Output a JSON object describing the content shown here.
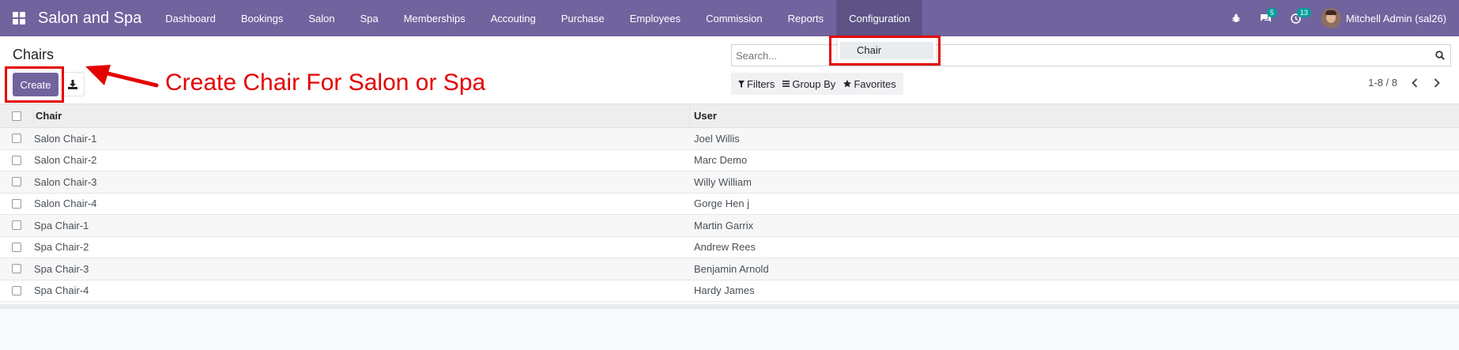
{
  "navbar": {
    "brand": "Salon and Spa",
    "menu": [
      "Dashboard",
      "Bookings",
      "Salon",
      "Spa",
      "Memberships",
      "Accouting",
      "Purchase",
      "Employees",
      "Commission",
      "Reports",
      "Configuration"
    ],
    "messages_count": "5",
    "activities_count": "13",
    "user_name": "Mitchell Admin (sal26)",
    "bg_color": "#71639e"
  },
  "dropdown": {
    "item": "Chair"
  },
  "control": {
    "title": "Chairs",
    "create_label": "Create",
    "search_placeholder": "Search...",
    "filters_label": "Filters",
    "group_by_label": "Group By",
    "favorites_label": "Favorites",
    "pager": "1-8 / 8"
  },
  "table": {
    "headers": {
      "chair": "Chair",
      "user": "User"
    },
    "rows": [
      {
        "chair": "Salon Chair-1",
        "user": "Joel Willis"
      },
      {
        "chair": "Salon Chair-2",
        "user": "Marc Demo"
      },
      {
        "chair": "Salon Chair-3",
        "user": "Willy William"
      },
      {
        "chair": "Salon Chair-4",
        "user": "Gorge Hen j"
      },
      {
        "chair": "Spa Chair-1",
        "user": "Martin Garrix"
      },
      {
        "chair": "Spa Chair-2",
        "user": "Andrew Rees"
      },
      {
        "chair": "Spa Chair-3",
        "user": "Benjamin Arnold"
      },
      {
        "chair": "Spa Chair-4",
        "user": "Hardy James"
      }
    ]
  },
  "annotation": {
    "text": "Create Chair For Salon or Spa",
    "color": "#e50000"
  }
}
